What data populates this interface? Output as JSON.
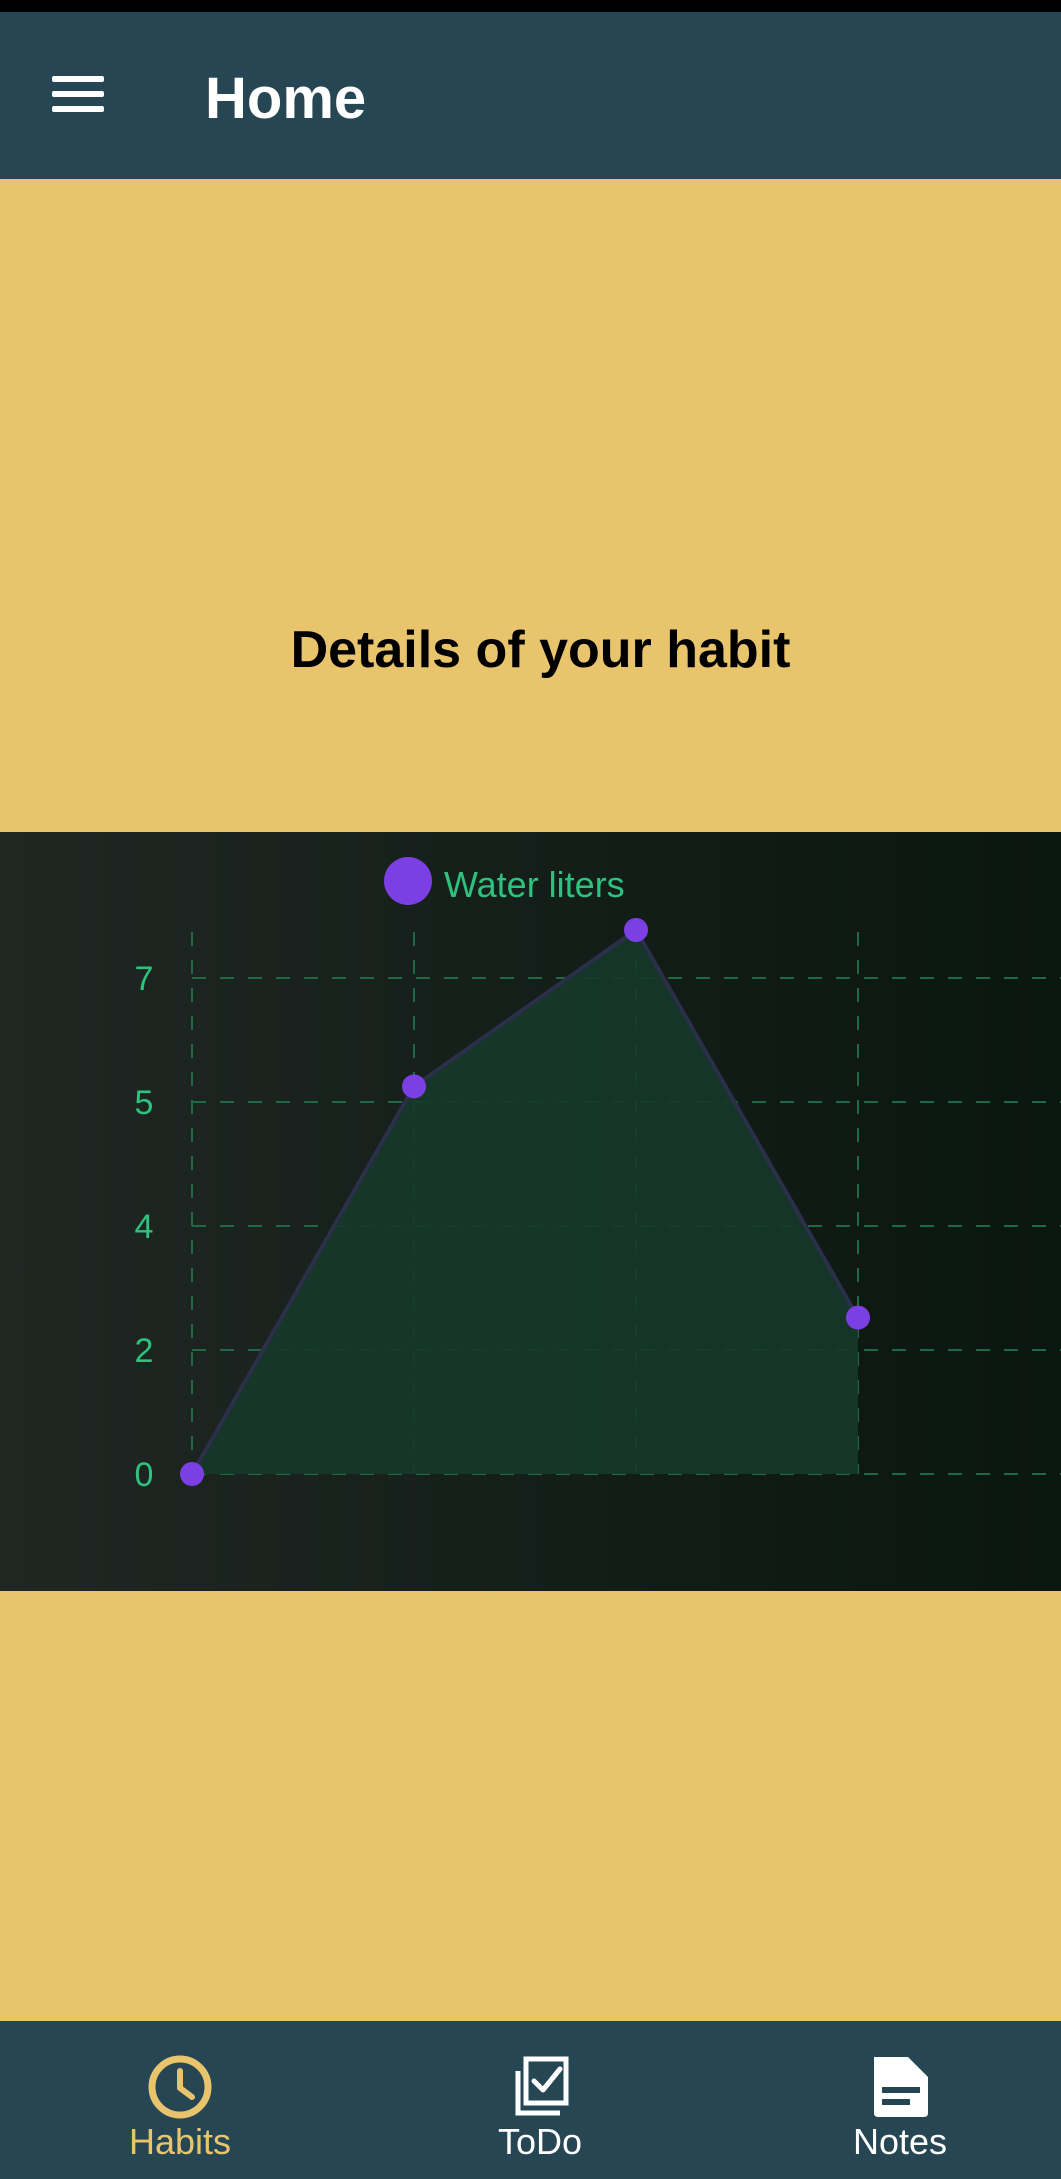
{
  "app": {
    "title": "Home",
    "menu_icon": "menu-icon"
  },
  "content": {
    "heading": "Details of your habit"
  },
  "colors": {
    "app_bar": "#264653",
    "page_background": "#E8C46D",
    "chart_line": "#2B2F4A",
    "chart_point": "#7B3FE4",
    "chart_fill": "#15382A",
    "chart_text": "#2EC27E",
    "nav_active": "#E8C46D",
    "nav_inactive": "#FFFFFF"
  },
  "chart_data": {
    "type": "area",
    "title": "",
    "xlabel": "",
    "ylabel": "",
    "x": [
      0,
      1,
      2,
      3
    ],
    "series": [
      {
        "name": "Water liters",
        "values": [
          0,
          5.7,
          8,
          2.3
        ]
      }
    ],
    "y_ticks": [
      0,
      2,
      4,
      5,
      7
    ],
    "ylim": [
      0,
      8
    ],
    "grid": true,
    "legend": "top-center"
  },
  "bottom_nav": [
    {
      "label": "Habits",
      "icon": "clock-icon",
      "active": true
    },
    {
      "label": "ToDo",
      "icon": "checklist-icon",
      "active": false
    },
    {
      "label": "Notes",
      "icon": "notes-icon",
      "active": false
    }
  ]
}
